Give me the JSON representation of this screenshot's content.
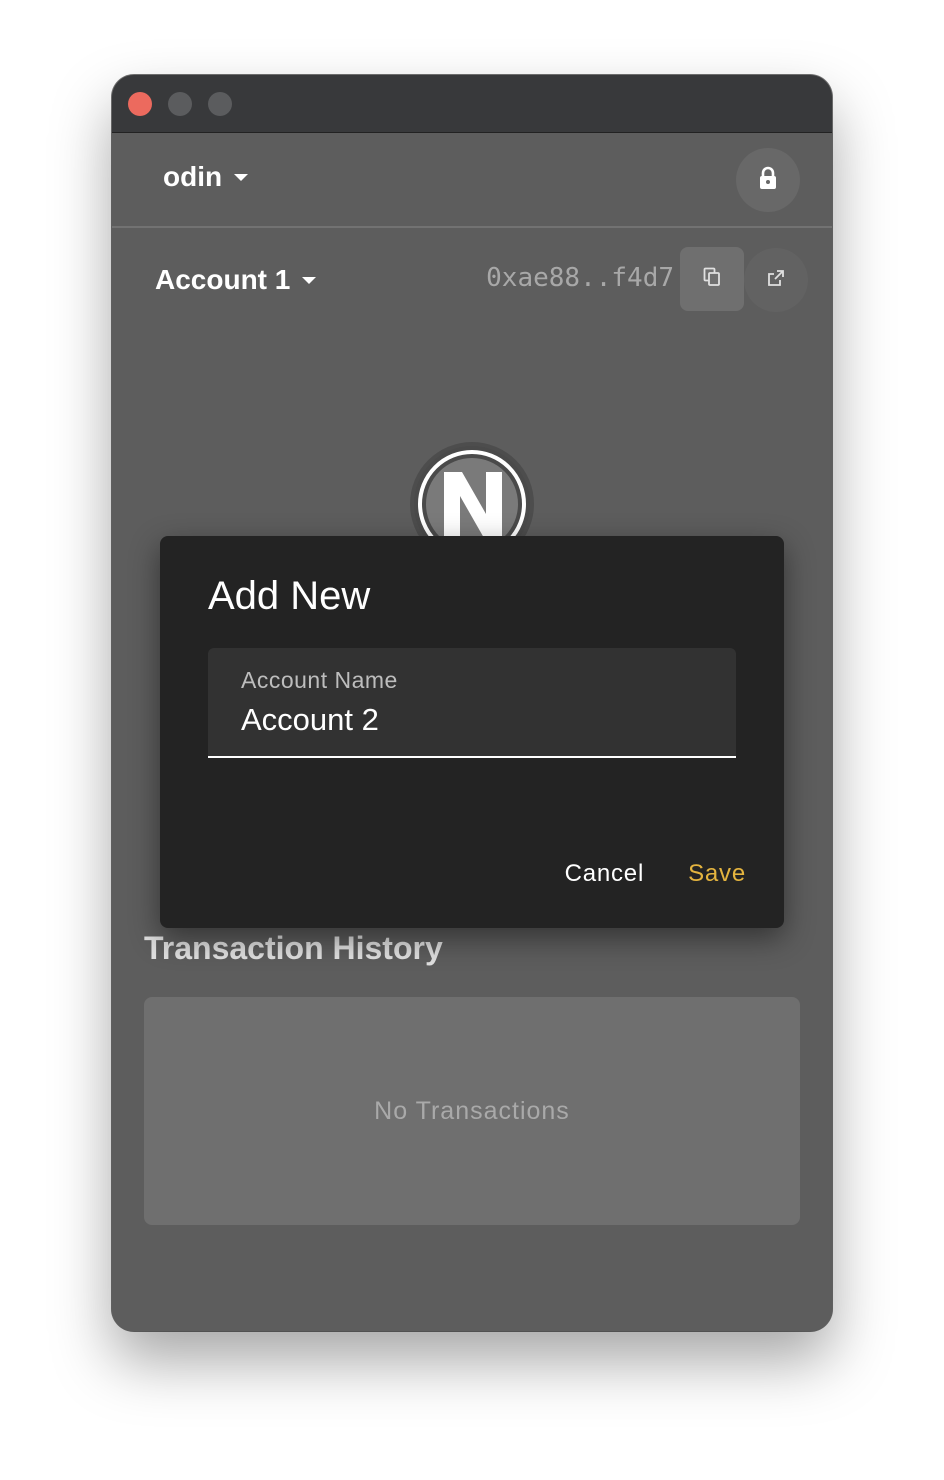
{
  "network": {
    "name": "odin"
  },
  "account": {
    "name": "Account 1",
    "address": "0xae88..f4d7"
  },
  "icons": {
    "lock": "lock-icon",
    "copy": "copy-icon",
    "external": "external-link-icon",
    "logo": "n-logo-icon"
  },
  "transactions": {
    "heading": "Transaction History",
    "empty_text": "No Transactions"
  },
  "dialog": {
    "title": "Add New",
    "field_label": "Account Name",
    "field_value": "Account 2",
    "cancel_label": "Cancel",
    "save_label": "Save"
  },
  "colors": {
    "accent": "#e4b43f",
    "close_button": "#ec6a5e",
    "background": "#5d5d5d",
    "dialog": "#232323"
  }
}
